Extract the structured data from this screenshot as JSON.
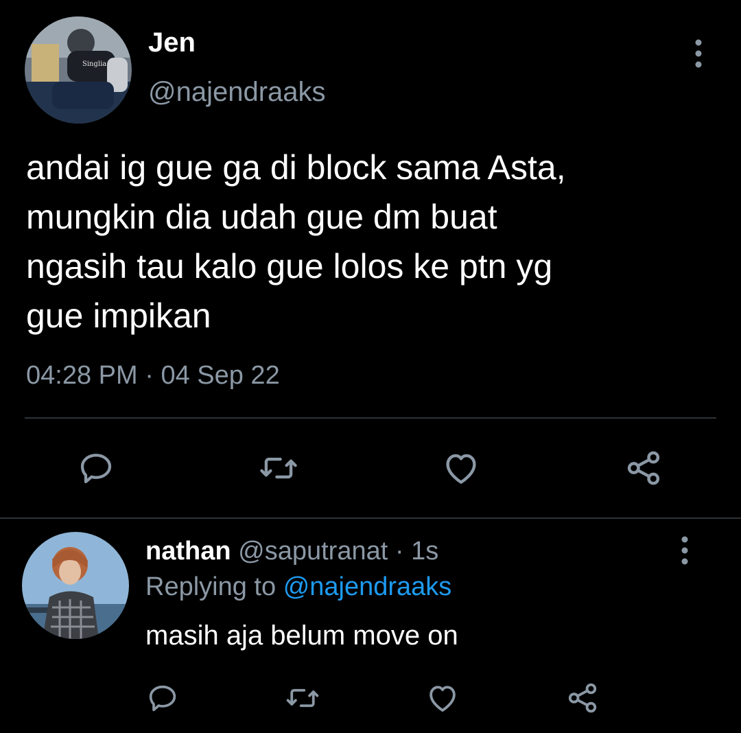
{
  "tweet": {
    "author_name": "Jen",
    "author_handle": "@najendraaks",
    "text_lines": [
      "andai ig gue ga di block sama Asta,",
      "mungkin dia udah gue dm buat",
      "ngasih tau kalo gue lolos ke ptn yg",
      "gue impikan"
    ],
    "time": "04:28 PM",
    "separator": "·",
    "date": "04 Sep 22",
    "actions": [
      "reply-icon",
      "retweet-icon",
      "like-icon",
      "share-icon"
    ]
  },
  "reply": {
    "author_name": "nathan",
    "author_handle": "@saputranat",
    "separator": "·",
    "time": "1s",
    "replying_prefix": "Replying to",
    "replying_handle": "@najendraaks",
    "text": "masih aja belum move on",
    "actions": [
      "reply-icon",
      "retweet-icon",
      "like-icon",
      "share-icon"
    ]
  },
  "colors": {
    "background": "#000000",
    "text_primary": "#ffffff",
    "text_secondary": "#8b98a5",
    "link": "#1d9bf0",
    "divider": "#2f3336"
  }
}
